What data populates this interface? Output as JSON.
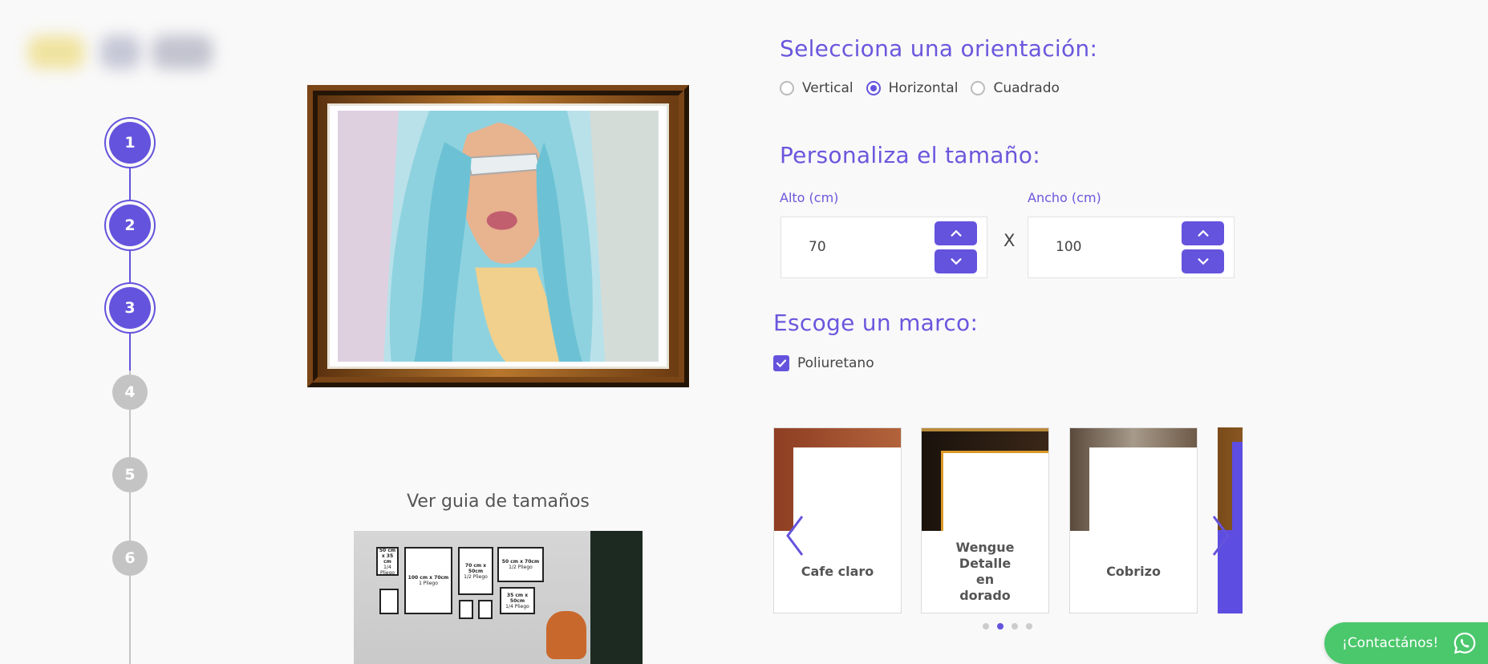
{
  "stepper": {
    "steps": [
      {
        "label": "1",
        "state": "active"
      },
      {
        "label": "2",
        "state": "active"
      },
      {
        "label": "3",
        "state": "active"
      },
      {
        "label": "4",
        "state": "inactive"
      },
      {
        "label": "5",
        "state": "inactive"
      },
      {
        "label": "6",
        "state": "inactive"
      }
    ]
  },
  "guide": {
    "title": "Ver guia de tamaños",
    "frames": [
      {
        "size": "50 cm x 35 cm",
        "sub": "1/4 Pliego"
      },
      {
        "size": "100 cm x 70cm",
        "sub": "1 Pliego"
      },
      {
        "size": "70 cm x 50cm",
        "sub": "1/2 Pliego"
      },
      {
        "size": "50 cm x 70cm",
        "sub": "1/2 Pliego"
      },
      {
        "size": "35 cm x 50cm",
        "sub": "1/4 Pliego"
      }
    ]
  },
  "orientation": {
    "title": "Selecciona una orientación:",
    "options": [
      "Vertical",
      "Horizontal",
      "Cuadrado"
    ],
    "selected": "Horizontal"
  },
  "size": {
    "title": "Personaliza el tamaño:",
    "alto_label": "Alto (cm)",
    "alto_value": "70",
    "ancho_label": "Ancho (cm)",
    "ancho_value": "100",
    "separator": "X"
  },
  "frame": {
    "title": "Escoge un marco:",
    "material_label": "Poliuretano",
    "material_checked": true,
    "cards": [
      {
        "name": "Cafe claro",
        "color": "#a5532f"
      },
      {
        "name": "Wengue Detalle en dorado",
        "color": "#2a1a0f"
      },
      {
        "name": "Cobrizo",
        "color": "#6e5a48"
      },
      {
        "name": "",
        "color": "#9a6a2a"
      }
    ],
    "dots": 4,
    "active_dot": 1
  },
  "contact": {
    "label": "¡Contactános!",
    "color": "#4bc76c"
  },
  "colors": {
    "accent": "#6453dd",
    "inactive": "#c4c4c4"
  }
}
